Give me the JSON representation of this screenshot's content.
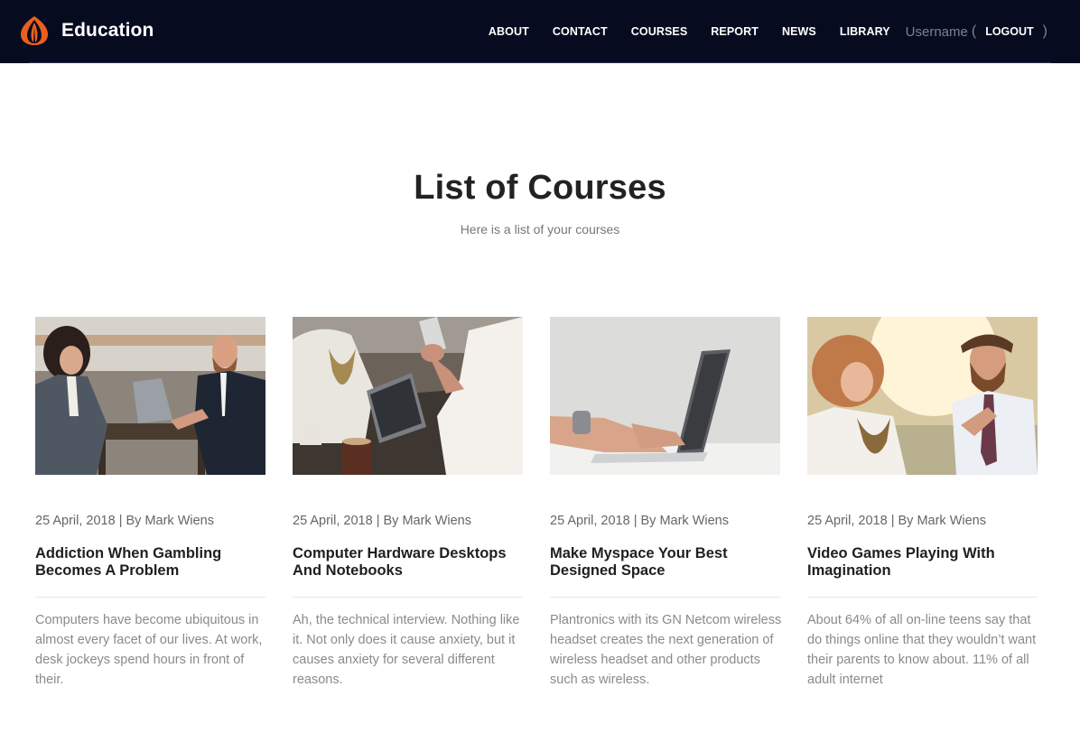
{
  "brand": {
    "name": "Education",
    "logo_icon": "flame-logo-icon",
    "accent": "#e8601c"
  },
  "nav": {
    "items": [
      "ABOUT",
      "CONTACT",
      "COURSES",
      "REPORT",
      "NEWS",
      "LIBRARY"
    ],
    "username": "Username",
    "open_paren": "(",
    "logout": "LOGOUT",
    "close_paren": ")"
  },
  "hero": {
    "title": "List of Courses",
    "subtitle": "Here is a list of your courses"
  },
  "courses": [
    {
      "meta": "25 April, 2018 | By Mark Wiens",
      "title": "Addiction When Gambling Becomes A Problem",
      "description": "Computers have become ubiquitous in almost every facet of our lives. At work, desk jockeys spend hours in front of their.",
      "image": "business-meeting-photo"
    },
    {
      "meta": "25 April, 2018 | By Mark Wiens",
      "title": "Computer Hardware Desktops And Notebooks",
      "description": "Ah, the technical interview. Nothing like it. Not only does it cause anxiety, but it causes anxiety for several different reasons.",
      "image": "cafe-tablet-phone-photo"
    },
    {
      "meta": "25 April, 2018 | By Mark Wiens",
      "title": "Make Myspace Your Best Designed Space",
      "description": "Plantronics with its GN Netcom wireless headset creates the next generation of wireless headset and other products such as wireless.",
      "image": "laptop-typing-photo"
    },
    {
      "meta": "25 April, 2018 | By Mark Wiens",
      "title": "Video Games Playing With Imagination",
      "description": "About 64% of all on-line teens say that do things online that they wouldn’t want their parents to know about. 11% of all adult internet",
      "image": "sunlit-couple-photo"
    }
  ]
}
